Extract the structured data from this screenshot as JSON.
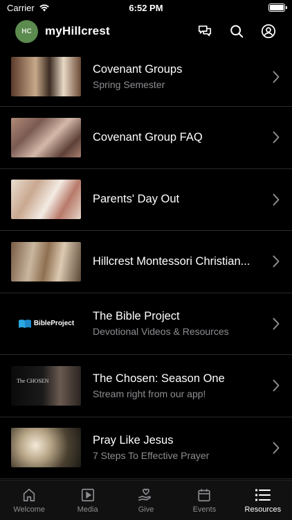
{
  "status_bar": {
    "carrier": "Carrier",
    "time": "6:52 PM"
  },
  "header": {
    "logo_text": "HC",
    "title": "myHillcrest",
    "icons": [
      "chat-icon",
      "search-icon",
      "profile-icon"
    ]
  },
  "list": {
    "items": [
      {
        "title": "Covenant Groups",
        "subtitle": "Spring Semester"
      },
      {
        "title": "Covenant Group FAQ",
        "subtitle": ""
      },
      {
        "title": "Parents' Day Out",
        "subtitle": ""
      },
      {
        "title": "Hillcrest Montessori Christian...",
        "subtitle": ""
      },
      {
        "title": "The Bible Project",
        "subtitle": "Devotional Videos & Resources",
        "thumb_text": "BibleProject"
      },
      {
        "title": "The Chosen: Season One",
        "subtitle": "Stream right from our app!",
        "thumb_text": "The CHOSEN"
      },
      {
        "title": "Pray Like Jesus",
        "subtitle": "7 Steps To Effective Prayer"
      }
    ]
  },
  "tabbar": {
    "tabs": [
      {
        "label": "Welcome",
        "icon": "home-icon"
      },
      {
        "label": "Media",
        "icon": "play-icon"
      },
      {
        "label": "Give",
        "icon": "give-icon"
      },
      {
        "label": "Events",
        "icon": "calendar-icon"
      },
      {
        "label": "Resources",
        "icon": "list-icon",
        "active": true
      }
    ]
  },
  "colors": {
    "background": "#000000",
    "subtitle": "#8e8e93",
    "divider": "#2a2a2a",
    "logo_green": "#5b8b4f"
  }
}
